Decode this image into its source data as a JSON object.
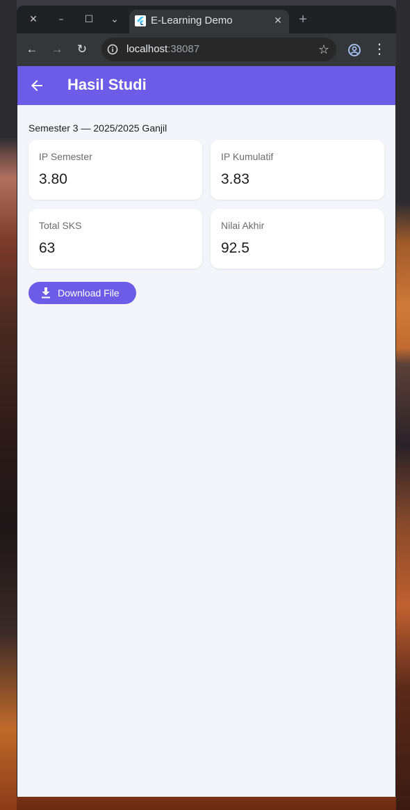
{
  "window": {
    "close_glyph": "✕",
    "minimize_glyph": "–",
    "maximize_glyph": "☐",
    "tab_list_glyph": "⌄"
  },
  "tab": {
    "title": "E-Learning Demo",
    "close_glyph": "✕"
  },
  "new_tab_glyph": "+",
  "toolbar": {
    "back_glyph": "←",
    "forward_glyph": "→",
    "reload_glyph": "↻",
    "url_host": "localhost",
    "url_port": ":38087",
    "bookmark_glyph": "☆",
    "menu_glyph": "⋮"
  },
  "app": {
    "title": "Hasil Studi",
    "accent_color": "#6c5ce7",
    "semester_label": "Semester 3 — 2025/2025 Ganjil",
    "cards": [
      {
        "label": "IP Semester",
        "value": "3.80"
      },
      {
        "label": "IP Kumulatif",
        "value": "3.83"
      },
      {
        "label": "Total SKS",
        "value": "63"
      },
      {
        "label": "Nilai Akhir",
        "value": "92.5"
      }
    ],
    "download_button_label": "Download File",
    "download_icon": "download-icon"
  }
}
